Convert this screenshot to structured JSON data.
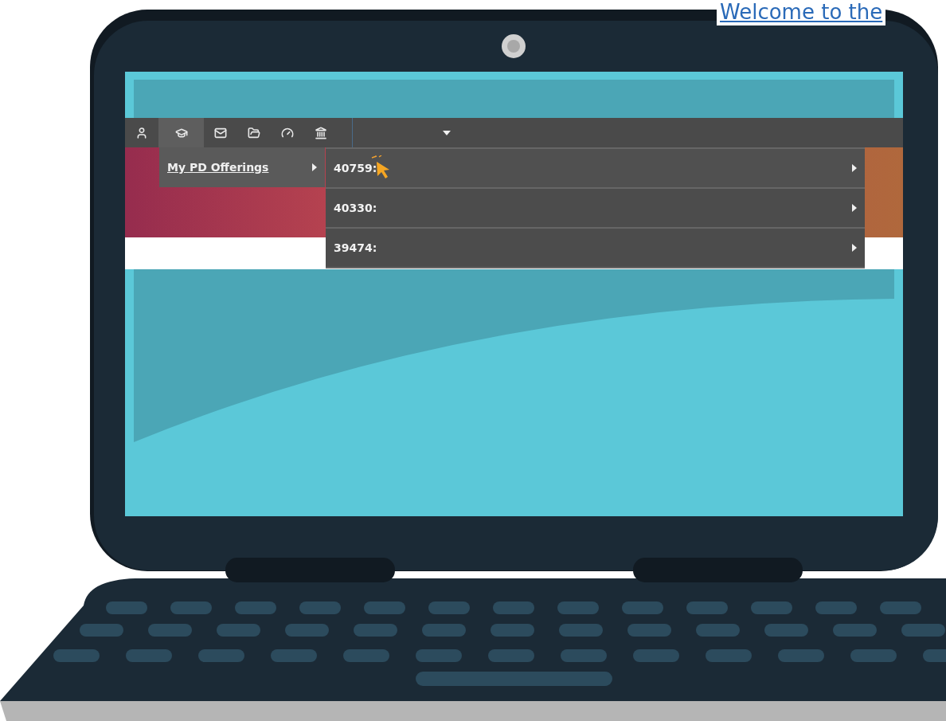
{
  "page": {
    "heading": "Welcome to the"
  },
  "screen": {
    "navbar": {
      "tabs": [
        {
          "kind": "user",
          "selected": false
        },
        {
          "kind": "cap",
          "selected": true
        },
        {
          "kind": "mail",
          "selected": false
        },
        {
          "kind": "folder",
          "selected": false
        },
        {
          "kind": "gauge",
          "selected": false
        },
        {
          "kind": "bank",
          "selected": false
        }
      ]
    },
    "menu": {
      "items": [
        {
          "label": "My PD Offerings",
          "expanded": true
        }
      ]
    },
    "submenu": {
      "items": [
        {
          "label": "40759:",
          "hovered": true
        },
        {
          "label": "40330:",
          "hovered": false
        },
        {
          "label": "39474:",
          "hovered": false
        }
      ]
    }
  }
}
